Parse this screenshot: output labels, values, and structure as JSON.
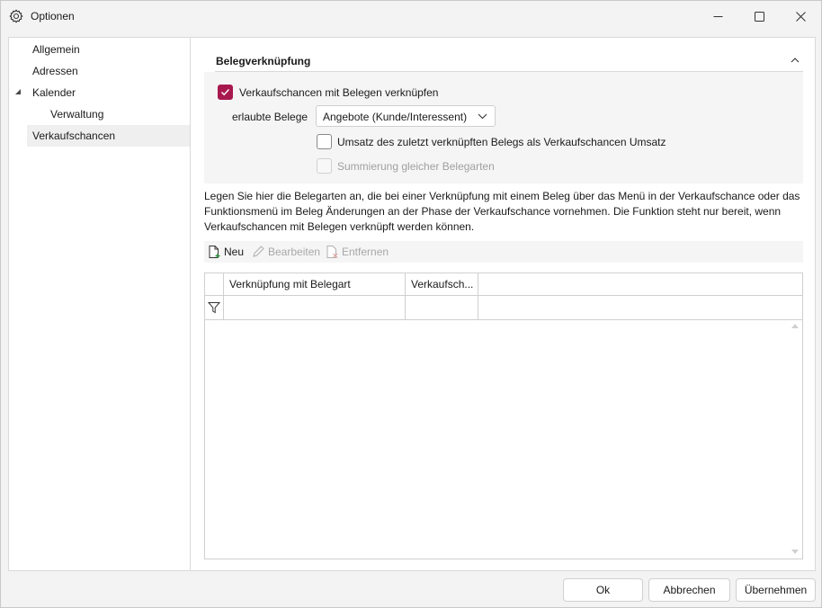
{
  "window": {
    "title": "Optionen"
  },
  "sidebar": {
    "items": [
      {
        "label": "Allgemein"
      },
      {
        "label": "Adressen"
      },
      {
        "label": "Kalender"
      },
      {
        "label": "Verwaltung"
      },
      {
        "label": "Verkaufschancen"
      }
    ]
  },
  "section": {
    "title": "Belegverknüpfung"
  },
  "options": {
    "link_checkbox_label": "Verkaufschancen mit Belegen verknüpfen",
    "link_checked": true,
    "allowed_label": "erlaubte Belege",
    "allowed_value": "Angebote (Kunde/Interessent)",
    "umsatz_label": "Umsatz des zuletzt verknüpften Belegs als Verkaufschancen Umsatz",
    "umsatz_checked": false,
    "summierung_label": "Summierung gleicher Belegarten",
    "summierung_enabled": false
  },
  "description": "Legen Sie hier die Belegarten an, die bei einer Verknüpfung mit einem Beleg über das Menü in der Verkaufschance oder das Funktionsmenü im Beleg Änderungen an der Phase der Verkaufschance vornehmen. Die Funktion steht nur bereit, wenn Verkaufschancen mit Belegen verknüpft werden können.",
  "toolbar": {
    "new_label": "Neu",
    "edit_label": "Bearbeiten",
    "remove_label": "Entfernen"
  },
  "grid": {
    "columns": [
      "Verknüpfung mit Belegart",
      "Verkaufsch..."
    ]
  },
  "footer": {
    "ok_label": "Ok",
    "cancel_label": "Abbrechen",
    "apply_label": "Übernehmen"
  },
  "colors": {
    "accent": "#a8184f"
  }
}
